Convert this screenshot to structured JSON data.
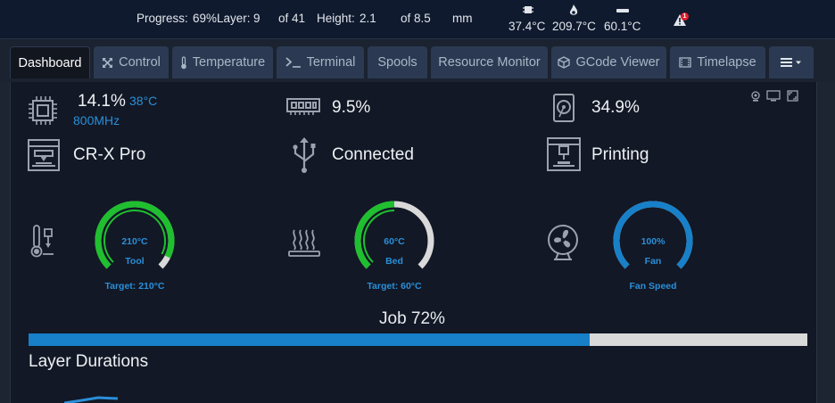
{
  "topbar": {
    "progress_label": "Progress:",
    "progress_value": "69%",
    "layer_label": "Layer:",
    "layer_value": "9",
    "layer_of": "of 41",
    "height_label": "Height:",
    "height_value": "2.1",
    "height_of": "of 8.5",
    "height_unit": "mm",
    "cpu_temp": "37.4°C",
    "tool_temp": "209.7°C",
    "bed_temp": "60.1°C",
    "warning_count": "1",
    "icons": [
      "chip-icon",
      "flame-icon",
      "bed-icon",
      "warning-icon"
    ]
  },
  "tabs": [
    {
      "label": "Dashboard",
      "icon": "",
      "active": true
    },
    {
      "label": "Control",
      "icon": "arrows-icon"
    },
    {
      "label": "Temperature",
      "icon": "thermometer-icon"
    },
    {
      "label": "Terminal",
      "icon": "terminal-icon"
    },
    {
      "label": "Spools",
      "icon": ""
    },
    {
      "label": "Resource Monitor",
      "icon": ""
    },
    {
      "label": "GCode Viewer",
      "icon": "cube-icon"
    },
    {
      "label": "Timelapse",
      "icon": "film-icon"
    },
    {
      "label": "",
      "icon": "menu-icon"
    }
  ],
  "system": {
    "cpu_usage": "14.1%",
    "cpu_temp": "38°C",
    "cpu_freq": "800MHz",
    "memory_usage": "9.5%",
    "disk_usage": "34.9%"
  },
  "status": {
    "printer_name": "CR-X Pro",
    "connection": "Connected",
    "state": "Printing"
  },
  "gauges": [
    {
      "id": "tool",
      "value_text": "210°C",
      "label": "Tool",
      "caption": "Target: 210°C",
      "fraction": 0.93,
      "color": "#1fbf2f"
    },
    {
      "id": "bed",
      "value_text": "60°C",
      "label": "Bed",
      "caption": "Target: 60°C",
      "fraction": 0.5,
      "color": "#1fbf2f"
    },
    {
      "id": "fan",
      "value_text": "100%",
      "label": "Fan",
      "caption": "Fan Speed",
      "fraction": 1.0,
      "color": "#1780c9"
    }
  ],
  "job": {
    "label": "Job",
    "percent_text": "72%",
    "fraction": 0.72
  },
  "layer_durations": {
    "title": "Layer Durations"
  },
  "colors": {
    "accent": "#2a8fd9",
    "ok_green": "#1fbf2f",
    "track": "#d9d9d9",
    "warning": "#e01e2a"
  }
}
